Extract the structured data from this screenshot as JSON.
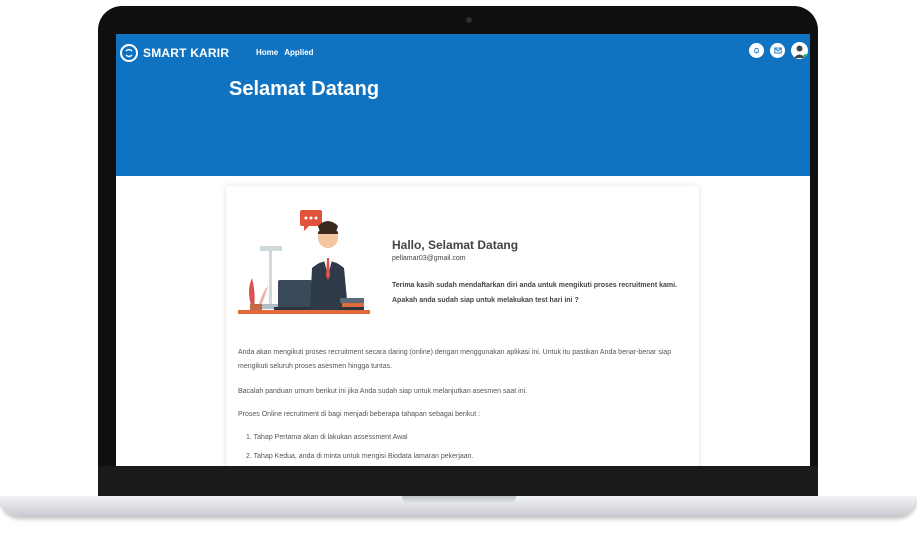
{
  "app": {
    "brand": "SMART KARIR"
  },
  "nav": {
    "home": "Home",
    "applied": "Applied"
  },
  "header_icons": [
    "bell-icon",
    "mail-icon",
    "user-avatar"
  ],
  "hero": {
    "title": "Selamat Datang"
  },
  "welcome": {
    "greeting": "Hallo, Selamat Datang",
    "email": "pellamar03@gmail.com",
    "line1": "Terima kasih sudah mendaftarkan diri anda untuk mengikuti proses recruitment kami.",
    "line2": "Apakah anda sudah siap untuk melakukan test hari ini ?"
  },
  "content": {
    "para1": "Anda akan mengikuti proses recruitment secara daring (online) dengan menggunakan aplikasi ini. Untuk itu pastikan Anda benar-benar siap mengikuti seluruh proses asesmen hingga tuntas.",
    "para2": "Bacalah panduan umum berikut ini jika Anda sudah siap untuk melanjutkan asesmen saat ini.",
    "para3": "Proses Online recruitment di bagi menjadi beberapa tahapan sebagai berikut :",
    "steps": [
      "1. Tahap Pertama akan di lakukan assessment Awal",
      "2. Tahap Kedua, anda di minta untuk mengisi Biodata lamaran pekerjaan."
    ]
  },
  "colors": {
    "primary": "#0f73c2",
    "text": "#444444"
  }
}
